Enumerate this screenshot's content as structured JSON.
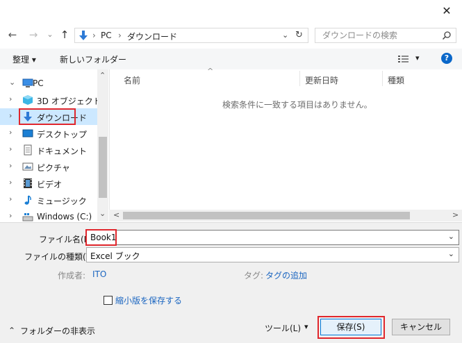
{
  "window": {
    "close_glyph": "✕"
  },
  "nav": {
    "back_glyph": "←",
    "forward_glyph": "→",
    "recent_glyph": "⌄",
    "up_glyph": "↑",
    "breadcrumb": [
      "PC",
      "ダウンロード"
    ],
    "breadcrumb_sep": "›",
    "dropdown_glyph": "⌄",
    "refresh_glyph": "↻",
    "search_placeholder": "ダウンロードの検索"
  },
  "toolbar": {
    "organize_label": "整理 ▾",
    "new_folder_label": "新しいフォルダー",
    "view_glyph": "▾",
    "help_glyph": "?"
  },
  "sidebar": {
    "items": [
      {
        "label": "PC",
        "chev": "⌄",
        "icon": "computer-icon"
      },
      {
        "label": "3D オブジェクト",
        "chev": "›",
        "icon": "3d-objects-icon"
      },
      {
        "label": "ダウンロード",
        "chev": "›",
        "icon": "download-icon",
        "selected": true
      },
      {
        "label": "デスクトップ",
        "chev": "›",
        "icon": "desktop-icon"
      },
      {
        "label": "ドキュメント",
        "chev": "›",
        "icon": "document-icon"
      },
      {
        "label": "ピクチャ",
        "chev": "›",
        "icon": "pictures-icon"
      },
      {
        "label": "ビデオ",
        "chev": "›",
        "icon": "video-icon"
      },
      {
        "label": "ミュージック",
        "chev": "›",
        "icon": "music-icon"
      },
      {
        "label": "Windows (C:)",
        "chev": "›",
        "icon": "drive-icon"
      }
    ],
    "scroll_up": "⌃",
    "scroll_down": "⌄"
  },
  "file_list": {
    "columns": [
      "名前",
      "更新日時",
      "種類"
    ],
    "sort_glyph": "^",
    "empty_message": "検索条件に一致する項目はありません。",
    "scroll_left": "<",
    "scroll_right": ">"
  },
  "form": {
    "filename_label": "ファイル名(N):",
    "filename_value": "Book1",
    "filetype_label": "ファイルの種類(T):",
    "filetype_value": "Excel ブック",
    "author_label": "作成者:",
    "author_value": "ITO",
    "tags_label": "タグ:",
    "tags_value": "タグの追加",
    "thumbnail_label": "縮小版を保存する",
    "hide_folders_label": "フォルダーの非表示",
    "hide_folders_glyph": "⌃",
    "tools_label": "ツール(L)",
    "tools_glyph": "▾",
    "save_label": "保存(S)",
    "cancel_label": "キャンセル"
  },
  "colors": {
    "accent": "#0078d7",
    "highlight": "#e0262c",
    "link": "#1a65c0"
  }
}
